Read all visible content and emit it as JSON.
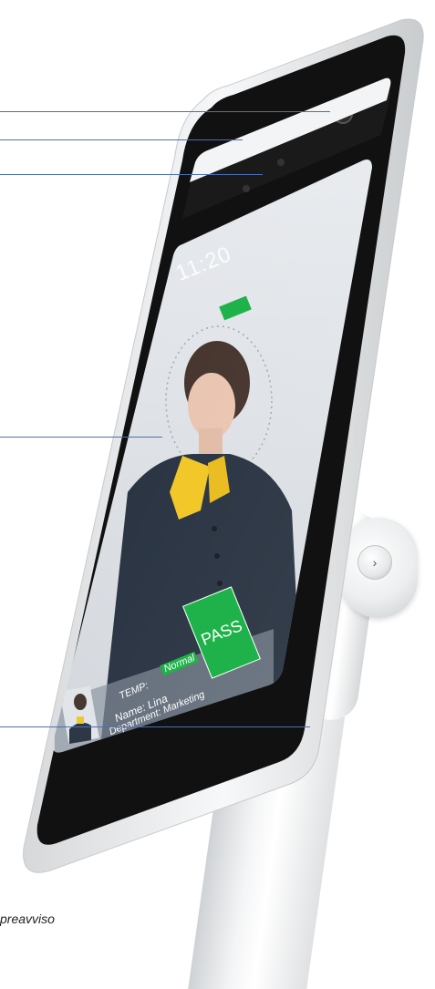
{
  "screen": {
    "time": "11:20",
    "info": {
      "temp_label": "TEMP:",
      "temp_status": "Normal",
      "name_line": "Name: Lina",
      "department_line": "Department: Marketing"
    },
    "result_button": "PASS"
  },
  "footnote": "preavviso",
  "colors": {
    "accent_green": "#1fb24a",
    "annotation_line": "#4a6fb5",
    "bezel": "#111111",
    "frame": "#e9ebec"
  }
}
